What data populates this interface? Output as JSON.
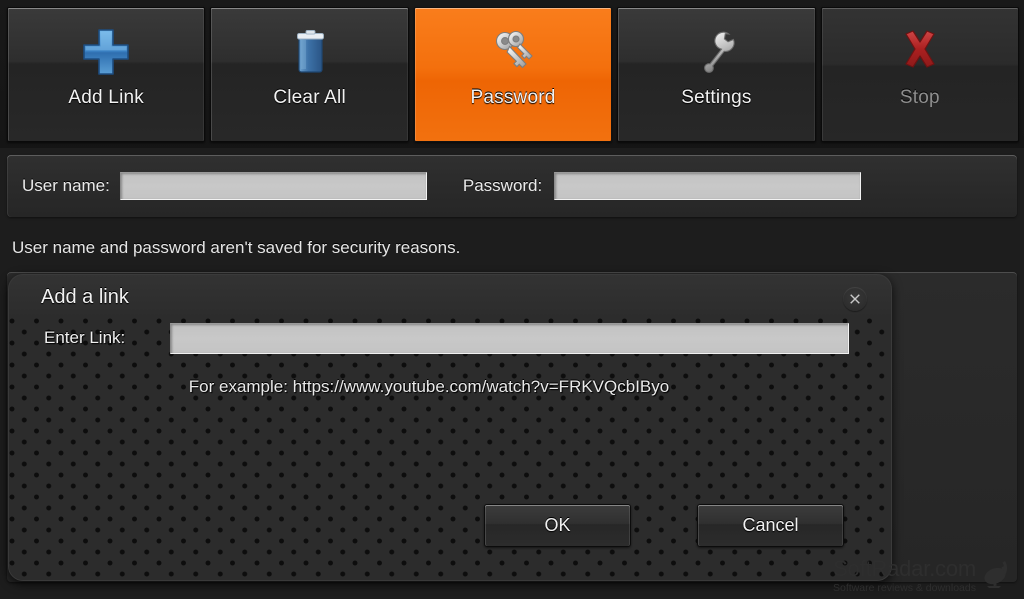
{
  "toolbar": {
    "buttons": [
      {
        "label": "Add Link",
        "icon": "plus-icon",
        "state": "normal"
      },
      {
        "label": "Clear All",
        "icon": "trash-bin-icon",
        "state": "normal"
      },
      {
        "label": "Password",
        "icon": "keys-icon",
        "state": "active"
      },
      {
        "label": "Settings",
        "icon": "wrench-icon",
        "state": "normal"
      },
      {
        "label": "Stop",
        "icon": "red-x-icon",
        "state": "disabled"
      }
    ],
    "active_color": "#f4700d"
  },
  "credentials": {
    "username_label": "User name:",
    "username_value": "",
    "password_label": "Password:",
    "password_value": "",
    "note": "User name and password aren't saved for security reasons."
  },
  "dialog": {
    "title": "Add a link",
    "close_icon": "close-icon",
    "enter_link_label": "Enter Link:",
    "enter_link_value": "",
    "example_text": "For example: https://www.youtube.com/watch?v=FRKVQcbIByo",
    "ok_label": "OK",
    "cancel_label": "Cancel"
  },
  "watermark": {
    "title": "SoftRadar.com",
    "subtitle": "Software reviews & downloads",
    "icon": "satellite-dish-icon"
  }
}
